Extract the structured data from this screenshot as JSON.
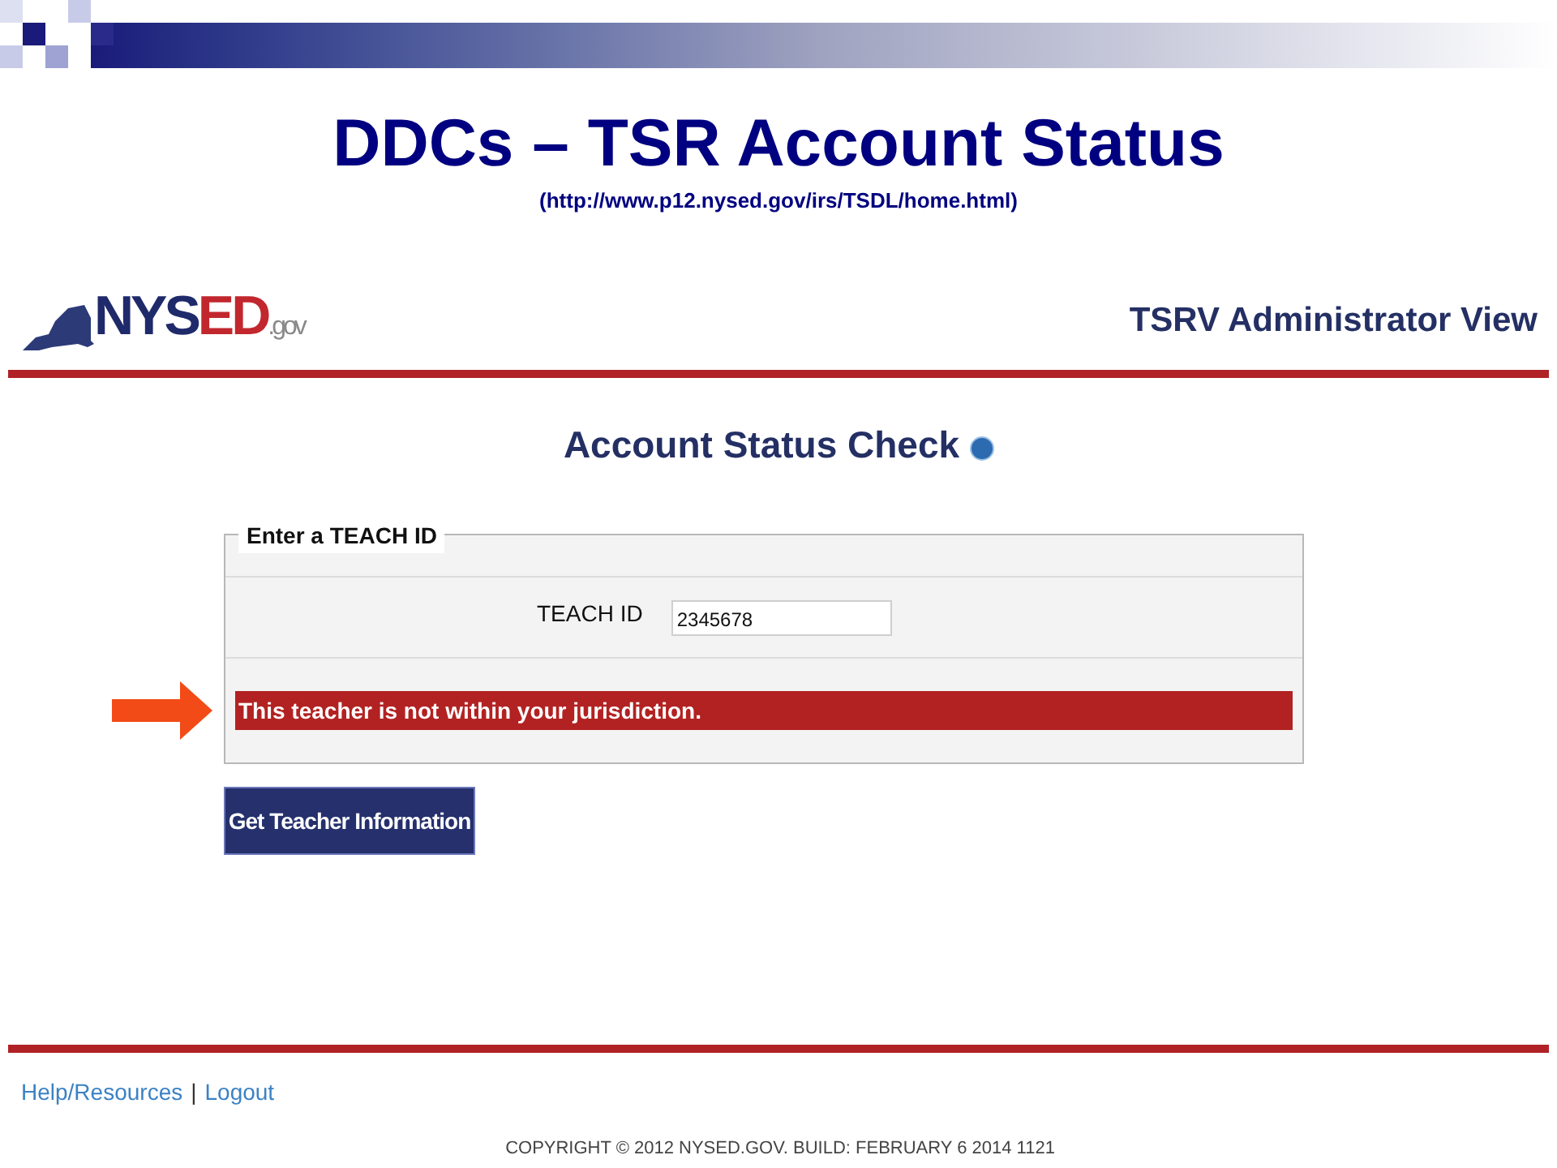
{
  "slide": {
    "title": "DDCs – TSR Account Status",
    "subtitle": "(http://www.p12.nysed.gov/irs/TSDL/home.html)"
  },
  "header": {
    "logo_parts": [
      "NYS",
      "ED",
      ".gov"
    ],
    "view_title": "TSRV Administrator View"
  },
  "page_title": "Account Status Check",
  "fieldset": {
    "legend": "Enter a TEACH ID",
    "field_label": "TEACH ID",
    "field_value": "2345678",
    "error": "This teacher is not within your jurisdiction."
  },
  "button": "Get Teacher Information",
  "footer": {
    "links": [
      "Help/Resources",
      "Logout"
    ],
    "separator": "|",
    "copyright": "COPYRIGHT © 2012 NYSED.GOV. BUILD: FEBRUARY 6 2014 1121"
  }
}
